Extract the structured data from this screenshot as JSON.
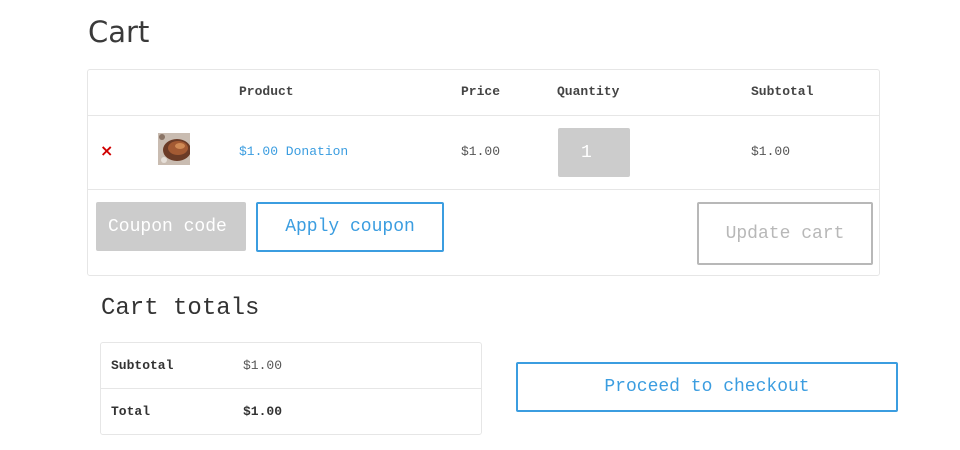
{
  "page": {
    "title": "Cart"
  },
  "cart_table": {
    "headers": {
      "product": "Product",
      "price": "Price",
      "quantity": "Quantity",
      "subtotal": "Subtotal"
    },
    "items": [
      {
        "remove_icon": "×",
        "product_name": "$1.00 Donation",
        "price": "$1.00",
        "quantity": "1",
        "subtotal": "$1.00"
      }
    ]
  },
  "coupon": {
    "placeholder": "Coupon code",
    "apply_label": "Apply coupon"
  },
  "update_cart_label": "Update cart",
  "cart_totals": {
    "title": "Cart totals",
    "subtotal_label": "Subtotal",
    "subtotal_value": "$1.00",
    "total_label": "Total",
    "total_value": "$1.00"
  },
  "checkout_label": "Proceed to checkout",
  "colors": {
    "accent": "#3b9de0",
    "remove": "#d00000",
    "input_bg": "#cccccc",
    "disabled_border": "#b8b8b8"
  }
}
